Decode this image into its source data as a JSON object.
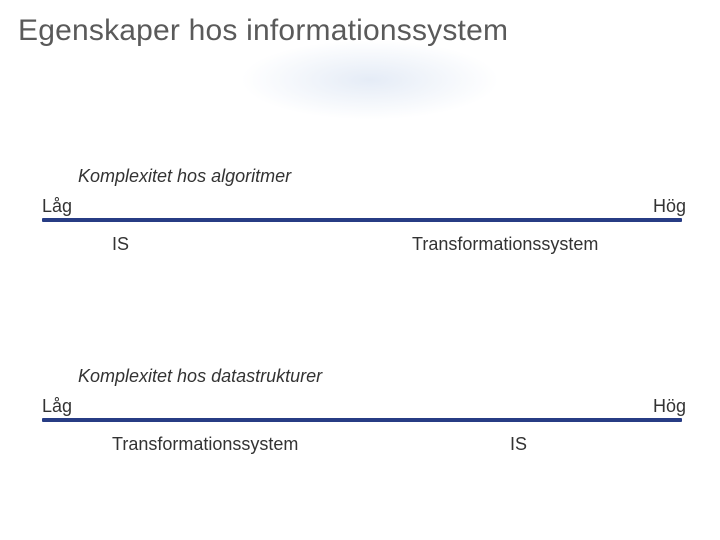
{
  "title": "Egenskaper hos informationssystem",
  "axis1": {
    "label": "Komplexitet hos algoritmer",
    "low": "Låg",
    "high": "Hög",
    "left_item": "IS",
    "right_item": "Transformationssystem"
  },
  "axis2": {
    "label": "Komplexitet hos datastrukturer",
    "low": "Låg",
    "high": "Hög",
    "left_item": "Transformationssystem",
    "right_item": "IS"
  },
  "colors": {
    "line": "#273c84",
    "title": "#5a5a5a",
    "text": "#333333"
  }
}
